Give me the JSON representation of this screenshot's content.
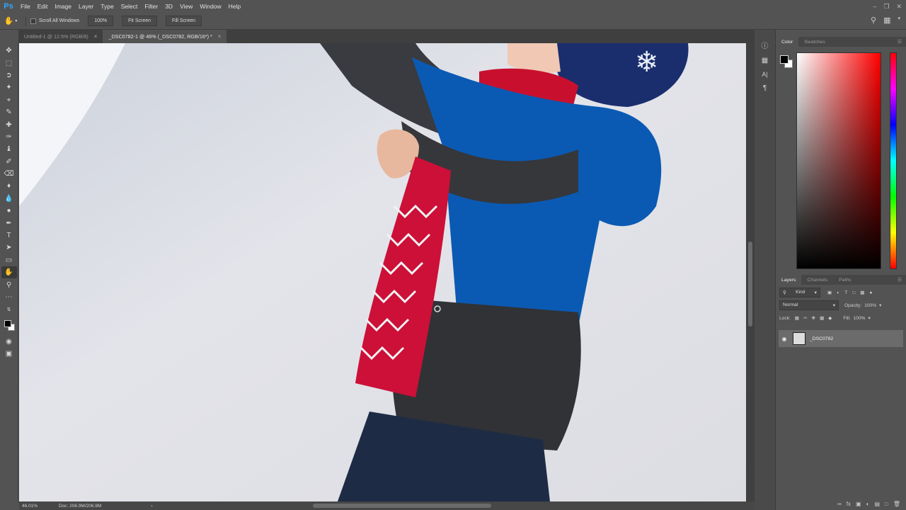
{
  "app": {
    "logo": "Ps",
    "menu": [
      "File",
      "Edit",
      "Image",
      "Layer",
      "Type",
      "Select",
      "Filter",
      "3D",
      "View",
      "Window",
      "Help"
    ]
  },
  "options": {
    "scroll_all_windows": "Scroll All Windows",
    "zoom": "100%",
    "fit_screen": "Fit Screen",
    "fill_screen": "Fill Screen"
  },
  "tabs": [
    {
      "label": "Untitled-1 @ 12.5% (RGB/8)",
      "close": "×"
    },
    {
      "label": "_DSC0782-1 @ 46% (_DSC0782, RGB/16*) *",
      "close": "×"
    }
  ],
  "status": {
    "zoom": "46.01%",
    "doc": "Doc: 206.9M/206.9M",
    "arrow": "›"
  },
  "color_panel": {
    "tabs": [
      "Color",
      "Swatches"
    ],
    "foreground": "#000000",
    "background": "#ffffff",
    "hue_color": "#ff0000"
  },
  "layers_panel": {
    "tabs": [
      "Layers",
      "Channels",
      "Paths"
    ],
    "filter_kind": "Kind",
    "blend_mode": "Normal",
    "opacity_label": "Opacity:",
    "opacity_value": "100%",
    "lock_label": "Lock:",
    "fill_label": "Fill:",
    "fill_value": "100%",
    "layers": [
      {
        "name": "_DSC0782",
        "visible": true
      }
    ]
  }
}
